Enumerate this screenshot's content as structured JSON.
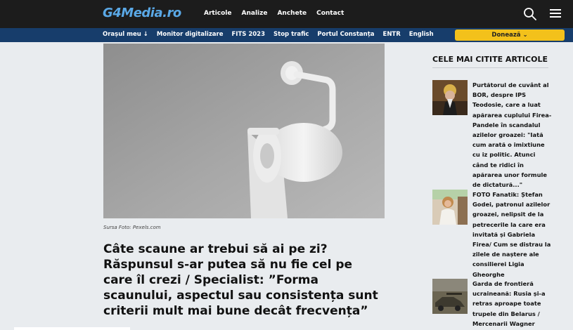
{
  "header": {
    "logo": "G4Media.ro",
    "nav": [
      "Articole",
      "Analize",
      "Anchete",
      "Contact"
    ]
  },
  "subnav": {
    "items": [
      "Orașul meu ↓",
      "Monitor digitalizare",
      "FITS 2023",
      "Stop trafic",
      "Portul Constanța",
      "ENTR",
      "English"
    ],
    "donate_label": "Donează ⌄"
  },
  "article": {
    "image_caption": "Sursa Foto: Pexels.com",
    "headline": "Câte scaune ar trebui să ai pe zi? Răspunsul s-ar putea să nu fie cel pe care îl crezi / Specialist: ”Forma scaunului, aspectul sau consistența sunt criterii mult mai bune decât frecvența”"
  },
  "sidebar": {
    "title": "CELE MAI CITITE ARTICOLE",
    "items": [
      {
        "text": "Purtătorul de cuvânt al BOR, despre IPS Teodosie, care a luat apărarea cuplului Firea-Pandele în scandalul azilelor groazei: \"Iată cum arată o imixtiune cu iz politic. Atunci când te ridici în apărarea unor formule de dictatură...\""
      },
      {
        "text": "FOTO Fanatik: Ștefan Godei, patronul azilelor groazei, nelipsit de la petrecerile la care era invitată și Gabriela Firea/ Cum se distrau la zilele de naștere ale consilierei Ligia Gheorghe"
      },
      {
        "text": "Garda de frontieră ucraineană: Rusia și-a retras aproape toate trupele din Belarus / Mercenarii Wagner"
      }
    ]
  },
  "colors": {
    "topbar": "#1c1c1c",
    "subbar": "#173d6b",
    "donate": "#f3c11b",
    "logo": "#5aa8e6"
  }
}
